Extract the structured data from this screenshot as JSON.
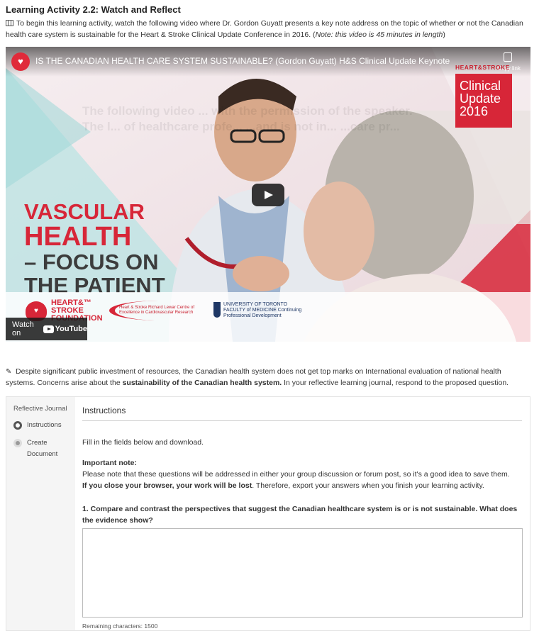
{
  "activity": {
    "heading": "Learning Activity 2.2: Watch and Reflect",
    "intro_text": "To begin this learning activity, watch the following video where Dr. Gordon Guyatt presents a key note address on the topic of whether or not the Canadian health care system is sustainable for the Heart & Stroke Clinical Update Conference in 2016. (",
    "intro_note": "Note: this video is 45 minutes in length",
    "intro_close": ")"
  },
  "video": {
    "title": "IS THE CANADIAN HEALTH CARE SYSTEM SUSTAINABLE? (Gordon Guyatt) H&S Clinical Update Keynote",
    "copy_label": "Copy link",
    "brand_small": "HEART&STROKE",
    "clinical_update": "Clinical Update 2016",
    "headline_1": "VASCULAR",
    "headline_2": "HEALTH",
    "headline_3": "– FOCUS ON",
    "headline_4": "THE PATIENT",
    "watermark": "The following video ... with the permission of the speaker. The l... of healthcare profe... ...and is not in... ...care pr...",
    "logo_hs": "HEART&™ STROKE FOUNDATION",
    "logo_lewar": "Heart & Stroke Richard Lewar Centre of Excellence in Cardiovascular Research",
    "logo_uoft": "UNIVERSITY OF TORONTO FACULTY of MEDICINE Continuing Professional Development",
    "watch_on": "Watch on",
    "youtube": "YouTube"
  },
  "prompt": {
    "text_before": "Despite significant public investment of resources, the Canadian health system does not get top marks on International evaluation of national health systems. Concerns arise about the ",
    "bold": "sustainability of the Canadian health system.",
    "text_after": " In your reflective learning journal, respond to the proposed question."
  },
  "journal": {
    "sidebar_title": "Reflective Journal",
    "steps": [
      {
        "label": "Instructions"
      },
      {
        "label": "Create Document"
      }
    ],
    "main_title": "Instructions",
    "fill_text": "Fill in the fields below and download.",
    "important_heading": "Important note:",
    "important_text": "Please note that these questions will be addressed in either your group discussion or forum post, so it's a good idea to save them.",
    "important_bold": "If you close your browser, your work will be lost",
    "important_after": ". Therefore, export your answers when you finish your learning activity.",
    "question_1": "1. Compare and contrast the perspectives that suggest the Canadian healthcare system is or is not sustainable. What does the evidence show?",
    "answer_value": "",
    "remaining": "Remaining characters: 1500"
  },
  "colors": {
    "brand_red": "#d72638",
    "text": "#333333"
  }
}
